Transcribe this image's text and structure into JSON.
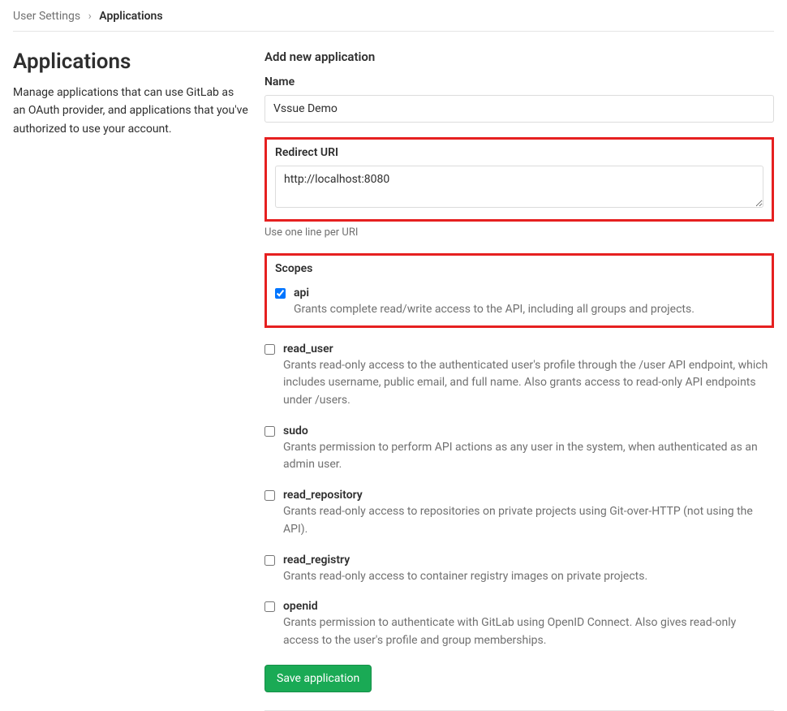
{
  "breadcrumb": {
    "parent": "User Settings",
    "current": "Applications"
  },
  "sidebar": {
    "title": "Applications",
    "description": "Manage applications that can use GitLab as an OAuth provider, and applications that you've authorized to use your account."
  },
  "form": {
    "section_title": "Add new application",
    "name_label": "Name",
    "name_value": "Vssue Demo",
    "redirect_label": "Redirect URI",
    "redirect_value": "http://localhost:8080",
    "redirect_help": "Use one line per URI",
    "scopes_label": "Scopes",
    "scopes": [
      {
        "key": "api",
        "label": "api",
        "description": "Grants complete read/write access to the API, including all groups and projects.",
        "checked": true,
        "highlighted": true
      },
      {
        "key": "read_user",
        "label": "read_user",
        "description": "Grants read-only access to the authenticated user's profile through the /user API endpoint, which includes username, public email, and full name. Also grants access to read-only API endpoints under /users.",
        "checked": false,
        "highlighted": false
      },
      {
        "key": "sudo",
        "label": "sudo",
        "description": "Grants permission to perform API actions as any user in the system, when authenticated as an admin user.",
        "checked": false,
        "highlighted": false
      },
      {
        "key": "read_repository",
        "label": "read_repository",
        "description": "Grants read-only access to repositories on private projects using Git-over-HTTP (not using the API).",
        "checked": false,
        "highlighted": false
      },
      {
        "key": "read_registry",
        "label": "read_registry",
        "description": "Grants read-only access to container registry images on private projects.",
        "checked": false,
        "highlighted": false
      },
      {
        "key": "openid",
        "label": "openid",
        "description": "Grants permission to authenticate with GitLab using OpenID Connect. Also gives read-only access to the user's profile and group memberships.",
        "checked": false,
        "highlighted": false
      }
    ],
    "save_label": "Save application"
  }
}
